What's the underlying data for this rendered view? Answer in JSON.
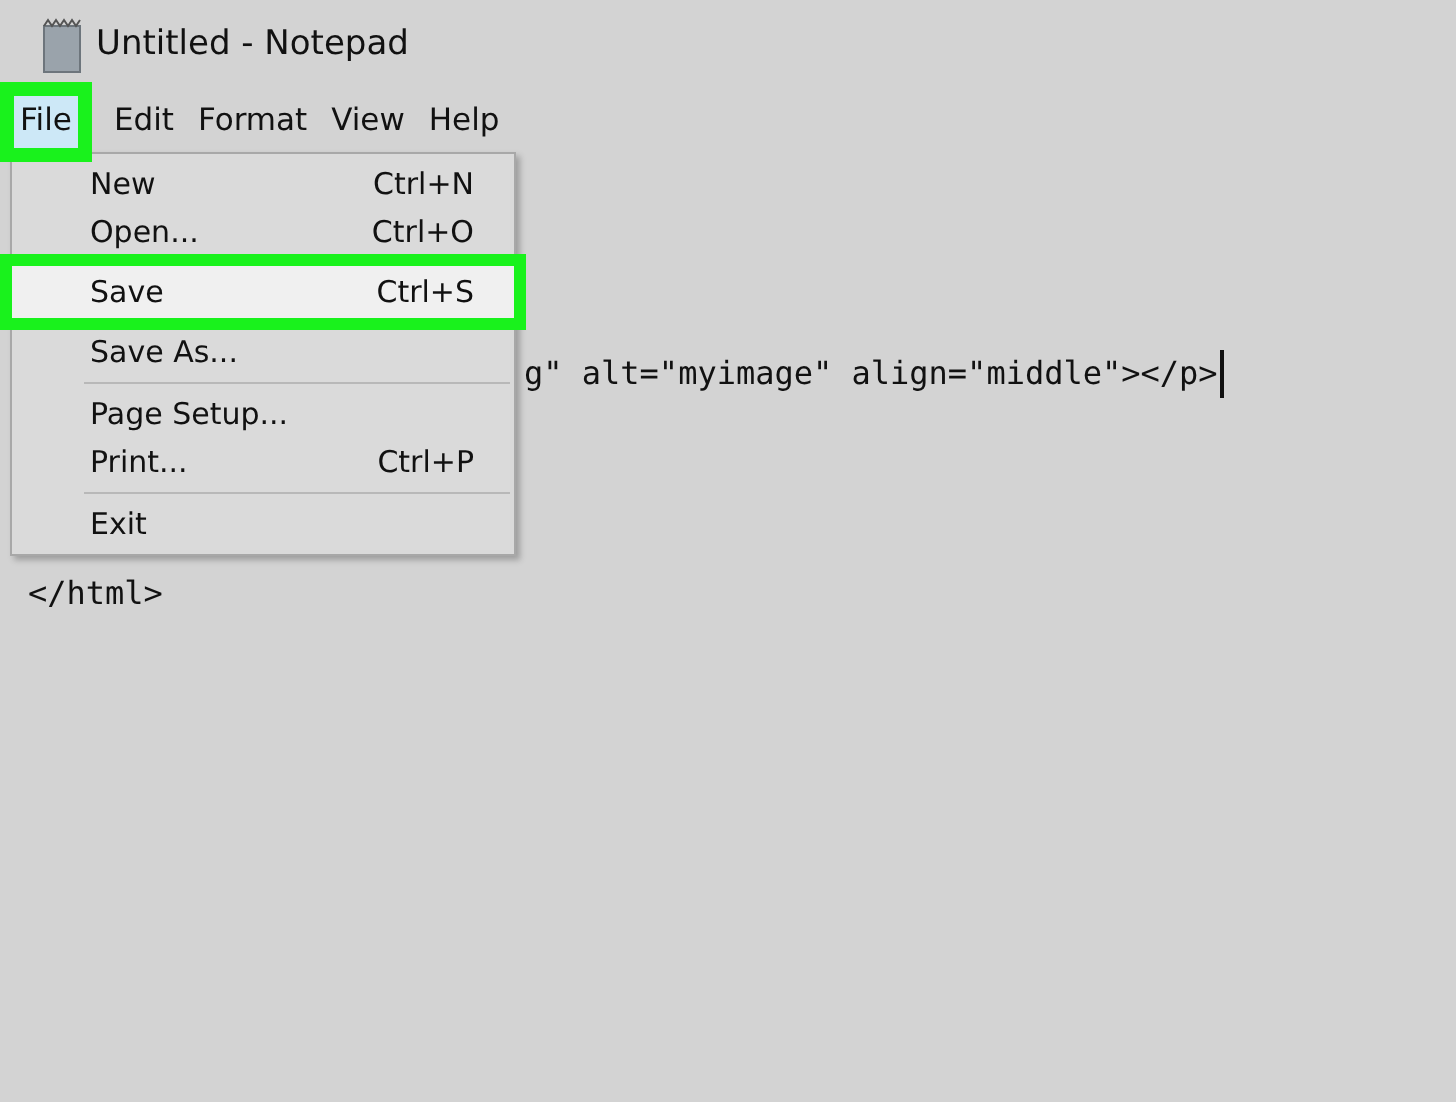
{
  "window": {
    "title": "Untitled - Notepad"
  },
  "menu_bar": [
    {
      "label": "File",
      "selected": true,
      "annotated": true
    },
    {
      "label": "Edit",
      "selected": false,
      "annotated": false
    },
    {
      "label": "Format",
      "selected": false,
      "annotated": false
    },
    {
      "label": "View",
      "selected": false,
      "annotated": false
    },
    {
      "label": "Help",
      "selected": false,
      "annotated": false
    }
  ],
  "file_menu": {
    "items": [
      {
        "kind": "item",
        "label": "New",
        "shortcut": "Ctrl+N",
        "highlighted": false,
        "annotated": false
      },
      {
        "kind": "item",
        "label": "Open...",
        "shortcut": "Ctrl+O",
        "highlighted": false,
        "annotated": false
      },
      {
        "kind": "item",
        "label": "Save",
        "shortcut": "Ctrl+S",
        "highlighted": true,
        "annotated": true
      },
      {
        "kind": "item",
        "label": "Save As...",
        "highlighted": false,
        "annotated": false
      },
      {
        "kind": "separator"
      },
      {
        "kind": "item",
        "label": "Page Setup...",
        "highlighted": false,
        "annotated": false
      },
      {
        "kind": "item",
        "label": "Print...",
        "shortcut": "Ctrl+P",
        "highlighted": false,
        "annotated": false
      },
      {
        "kind": "separator"
      },
      {
        "kind": "item",
        "label": "Exit",
        "highlighted": false,
        "annotated": false
      }
    ]
  },
  "editor": {
    "lines": [
      {
        "text": "g\" alt=\"myimage\" align=\"middle\"></p>",
        "cursor": true
      },
      {
        "text": "</html>",
        "cursor": false
      }
    ]
  }
}
